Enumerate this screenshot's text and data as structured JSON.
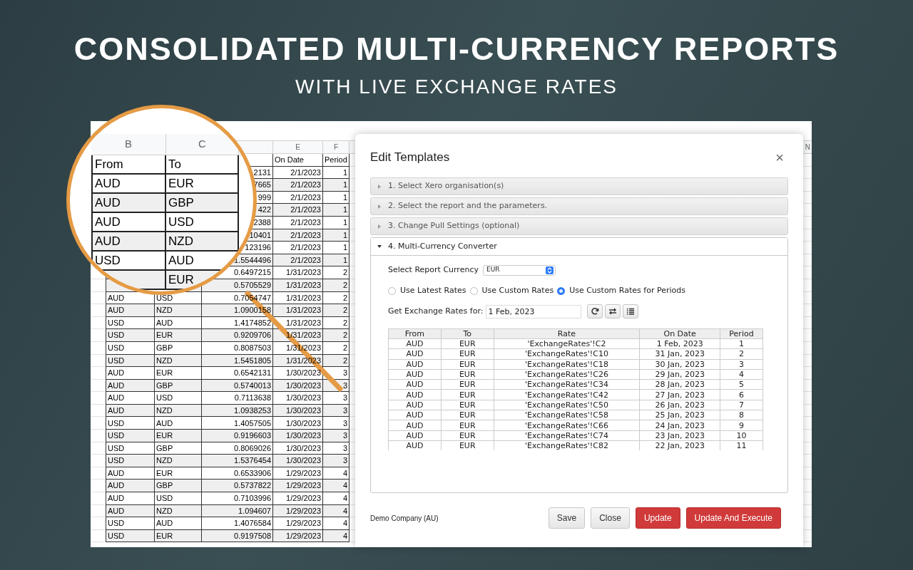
{
  "headline": {
    "title": "CONSOLIDATED MULTI-CURRENCY REPORTS",
    "subtitle": "WITH LIVE EXCHANGE RATES"
  },
  "sheet": {
    "column_letters": [
      "E",
      "F"
    ],
    "edge_column_letter": "N",
    "header": [
      "On Date",
      "Period"
    ],
    "rows": [
      {
        "rate": "2131",
        "date": "2/1/2023",
        "period": "1"
      },
      {
        "rate": "7665",
        "date": "2/1/2023",
        "period": "1"
      },
      {
        "rate": "999",
        "date": "2/1/2023",
        "period": "1"
      },
      {
        "rate": "422",
        "date": "2/1/2023",
        "period": "1"
      },
      {
        "rate": "2388",
        "date": "2/1/2023",
        "period": "1"
      },
      {
        "rate": "10401",
        "date": "2/1/2023",
        "period": "1"
      },
      {
        "rate": "123196",
        "date": "2/1/2023",
        "period": "1"
      },
      {
        "rate": "1.5544496",
        "date": "2/1/2023",
        "period": "1"
      },
      {
        "rate": "0.6497215",
        "date": "1/31/2023",
        "period": "2"
      },
      {
        "rate": "0.5705529",
        "date": "1/31/2023",
        "period": "2"
      },
      {
        "from": "AUD",
        "to": "USD",
        "rate": "0.7054747",
        "date": "1/31/2023",
        "period": "2"
      },
      {
        "from": "AUD",
        "to": "NZD",
        "rate": "1.0900158",
        "date": "1/31/2023",
        "period": "2"
      },
      {
        "from": "USD",
        "to": "AUD",
        "rate": "1.4174852",
        "date": "1/31/2023",
        "period": "2"
      },
      {
        "from": "USD",
        "to": "EUR",
        "rate": "0.9209706",
        "date": "1/31/2023",
        "period": "2"
      },
      {
        "from": "USD",
        "to": "GBP",
        "rate": "0.8087503",
        "date": "1/31/2023",
        "period": "2"
      },
      {
        "from": "USD",
        "to": "NZD",
        "rate": "1.5451805",
        "date": "1/31/2023",
        "period": "2"
      },
      {
        "from": "AUD",
        "to": "EUR",
        "rate": "0.6542131",
        "date": "1/30/2023",
        "period": "3"
      },
      {
        "from": "AUD",
        "to": "GBP",
        "rate": "0.5740013",
        "date": "1/30/2023",
        "period": "3"
      },
      {
        "from": "AUD",
        "to": "USD",
        "rate": "0.7113638",
        "date": "1/30/2023",
        "period": "3"
      },
      {
        "from": "AUD",
        "to": "NZD",
        "rate": "1.0938253",
        "date": "1/30/2023",
        "period": "3"
      },
      {
        "from": "USD",
        "to": "AUD",
        "rate": "1.4057505",
        "date": "1/30/2023",
        "period": "3"
      },
      {
        "from": "USD",
        "to": "EUR",
        "rate": "0.9196603",
        "date": "1/30/2023",
        "period": "3"
      },
      {
        "from": "USD",
        "to": "GBP",
        "rate": "0.8069026",
        "date": "1/30/2023",
        "period": "3"
      },
      {
        "from": "USD",
        "to": "NZD",
        "rate": "1.5376454",
        "date": "1/30/2023",
        "period": "3"
      },
      {
        "from": "AUD",
        "to": "EUR",
        "rate": "0.6533906",
        "date": "1/29/2023",
        "period": "4"
      },
      {
        "from": "AUD",
        "to": "GBP",
        "rate": "0.5737822",
        "date": "1/29/2023",
        "period": "4"
      },
      {
        "from": "AUD",
        "to": "USD",
        "rate": "0.7103996",
        "date": "1/29/2023",
        "period": "4"
      },
      {
        "from": "AUD",
        "to": "NZD",
        "rate": "1.094607",
        "date": "1/29/2023",
        "period": "4"
      },
      {
        "from": "USD",
        "to": "AUD",
        "rate": "1.4076584",
        "date": "1/29/2023",
        "period": "4"
      },
      {
        "from": "USD",
        "to": "EUR",
        "rate": "0.9197508",
        "date": "1/29/2023",
        "period": "4"
      }
    ]
  },
  "magnifier": {
    "column_letters": [
      "B",
      "C"
    ],
    "header": [
      "From",
      "To"
    ],
    "rows": [
      {
        "from": "AUD",
        "to": "EUR"
      },
      {
        "from": "AUD",
        "to": "GBP"
      },
      {
        "from": "AUD",
        "to": "USD"
      },
      {
        "from": "AUD",
        "to": "NZD"
      },
      {
        "from": "USD",
        "to": "AUD"
      },
      {
        "to": "EUR"
      }
    ]
  },
  "dialog": {
    "title": "Edit Templates",
    "close": "×",
    "sections": [
      {
        "label": "1. Select Xero organisation(s)",
        "expanded": false
      },
      {
        "label": "2. Select the report and the parameters.",
        "expanded": false
      },
      {
        "label": "3. Change Pull Settings (optional)",
        "expanded": false
      },
      {
        "label": "4. Multi-Currency Converter",
        "expanded": true
      }
    ],
    "converter": {
      "currency_label": "Select Report Currency",
      "currency": "EUR",
      "rate_options": [
        {
          "label": "Use Latest Rates",
          "selected": false
        },
        {
          "label": "Use Custom Rates",
          "selected": false
        },
        {
          "label": "Use Custom Rates for Periods",
          "selected": true
        }
      ],
      "date_label": "Get Exchange Rates for:",
      "date": "1 Feb, 2023",
      "table": {
        "columns": [
          "From",
          "To",
          "Rate",
          "On Date",
          "Period"
        ],
        "rows": [
          [
            "AUD",
            "EUR",
            "'ExchangeRates'!C2",
            "1 Feb, 2023",
            "1"
          ],
          [
            "AUD",
            "EUR",
            "'ExchangeRates'!C10",
            "31 Jan, 2023",
            "2"
          ],
          [
            "AUD",
            "EUR",
            "'ExchangeRates'!C18",
            "30 Jan, 2023",
            "3"
          ],
          [
            "AUD",
            "EUR",
            "'ExchangeRates'!C26",
            "29 Jan, 2023",
            "4"
          ],
          [
            "AUD",
            "EUR",
            "'ExchangeRates'!C34",
            "28 Jan, 2023",
            "5"
          ],
          [
            "AUD",
            "EUR",
            "'ExchangeRates'!C42",
            "27 Jan, 2023",
            "6"
          ],
          [
            "AUD",
            "EUR",
            "'ExchangeRates'!C50",
            "26 Jan, 2023",
            "7"
          ],
          [
            "AUD",
            "EUR",
            "'ExchangeRates'!C58",
            "25 Jan, 2023",
            "8"
          ],
          [
            "AUD",
            "EUR",
            "'ExchangeRates'!C66",
            "24 Jan, 2023",
            "9"
          ],
          [
            "AUD",
            "EUR",
            "'ExchangeRates'!C74",
            "23 Jan, 2023",
            "10"
          ],
          [
            "AUD",
            "EUR",
            "'ExchangeRates'!C82",
            "22 Jan, 2023",
            "11"
          ]
        ]
      }
    },
    "company": "Demo Company (AU)",
    "buttons": [
      {
        "label": "Save",
        "kind": "plain"
      },
      {
        "label": "Close",
        "kind": "plain"
      },
      {
        "label": "Update",
        "kind": "primary"
      },
      {
        "label": "Update And Execute",
        "kind": "primary"
      }
    ]
  }
}
